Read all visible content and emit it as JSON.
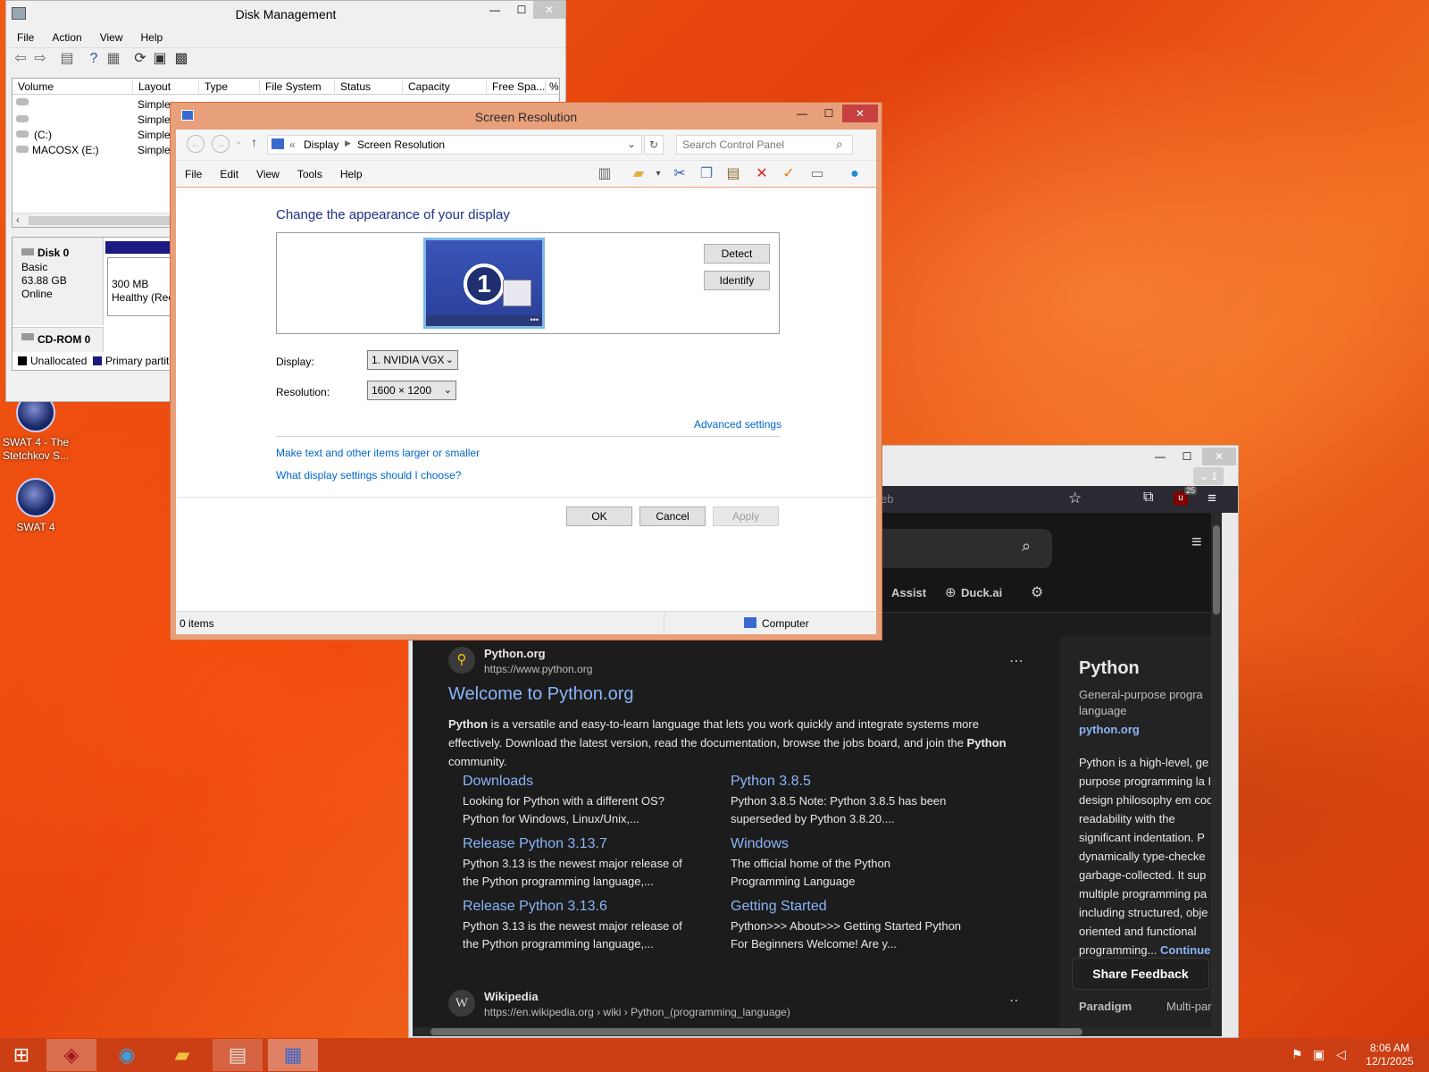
{
  "desktop": {
    "icons": [
      {
        "label": "SWAT 4 - The Stetchkov S..."
      },
      {
        "label": "SWAT 4"
      }
    ]
  },
  "disk_mgmt": {
    "title": "Disk Management",
    "menu": [
      "File",
      "Action",
      "View",
      "Help"
    ],
    "columns": [
      "Volume",
      "Layout",
      "Type",
      "File System",
      "Status",
      "Capacity",
      "Free Spa...",
      "%"
    ],
    "rows": [
      {
        "volume": "",
        "layout": "Simple"
      },
      {
        "volume": "",
        "layout": "Simple"
      },
      {
        "volume": "(C:)",
        "layout": "Simple"
      },
      {
        "volume": "MACOSX (E:)",
        "layout": "Simple"
      }
    ],
    "disk0": {
      "name": "Disk 0",
      "type": "Basic",
      "size": "63.88 GB",
      "status": "Online",
      "part_size": "300 MB",
      "part_status": "Healthy (Rec"
    },
    "cdrom": {
      "name": "CD-ROM 0"
    },
    "legend": {
      "unallocated": "Unallocated",
      "primary": "Primary partit"
    }
  },
  "screen_res": {
    "title": "Screen Resolution",
    "breadcrumb": {
      "prefix": "«",
      "part1": "Display",
      "part2": "Screen Resolution"
    },
    "search_placeholder": "Search Control Panel",
    "menu": [
      "File",
      "Edit",
      "View",
      "Tools",
      "Help"
    ],
    "heading": "Change the appearance of your display",
    "monitor_number": "1",
    "detect_label": "Detect",
    "identify_label": "Identify",
    "display_label": "Display:",
    "display_value": "1. NVIDIA VGX",
    "resolution_label": "Resolution:",
    "resolution_value": "1600 × 1200",
    "advanced_link": "Advanced settings",
    "link_text_size": "Make text and other items larger or smaller",
    "link_choose": "What display settings should I choose?",
    "ok_label": "OK",
    "cancel_label": "Cancel",
    "apply_label": "Apply",
    "status_items": "0 items",
    "status_computer": "Computer"
  },
  "browser": {
    "address_fragment": "eb",
    "tab_count": "1",
    "ext_badge": "25",
    "nav": {
      "assist": "Assist",
      "duckai": "Duck.ai"
    },
    "result1": {
      "site": "Python.org",
      "url": "https://www.python.org",
      "title": "Welcome to Python.org",
      "snippet_parts": [
        "Python",
        " is a versatile and easy-to-learn language that lets you work quickly and integrate systems more effectively. Download the latest version, read the documentation, browse the jobs board, and join the ",
        "Python",
        " community."
      ],
      "sitelinks": [
        {
          "title": "Downloads",
          "desc": "Looking for Python with a different OS? Python for Windows, Linux/Unix,..."
        },
        {
          "title": "Python 3.8.5",
          "desc": "Python 3.8.5 Note: Python 3.8.5 has been superseded by Python 3.8.20...."
        },
        {
          "title": "Release Python 3.13.7",
          "desc": "Python 3.13 is the newest major release of the Python programming language,..."
        },
        {
          "title": "Windows",
          "desc": "The official home of the Python Programming Language"
        },
        {
          "title": "Release Python 3.13.6",
          "desc": "Python 3.13 is the newest major release of the Python programming language,..."
        },
        {
          "title": "Getting Started",
          "desc": "Python>>> About>>> Getting Started Python For Beginners Welcome! Are y..."
        }
      ]
    },
    "result2": {
      "site": "Wikipedia",
      "url": "https://en.wikipedia.org › wiki › Python_(programming_language)"
    },
    "infobox": {
      "title": "Python",
      "subtitle": "General-purpose progra language",
      "link": "python.org",
      "body": "Python is a high-level, ge purpose programming la Its design philosophy em code readability with the significant indentation. P dynamically type-checke garbage-collected. It sup multiple programming pa including structured, obje oriented and functional programming...",
      "continue": "Continue",
      "row_label": "Paradigm",
      "row_value": "Multi-par"
    },
    "feedback_label": "Share Feedback"
  },
  "taskbar": {
    "time": "8:06 AM",
    "date": "12/1/2025"
  }
}
